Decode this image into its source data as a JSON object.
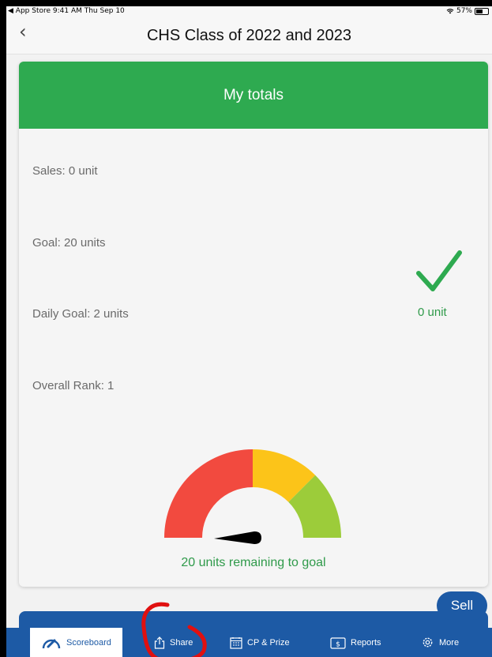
{
  "status_bar": {
    "left_text": "◀ App Store  9:41 AM  Thu Sep 10",
    "wifi_icon": "wifi-icon",
    "battery": "57%"
  },
  "nav": {
    "back_icon": "chevron-left-icon",
    "title": "CHS Class of 2022 and 2023"
  },
  "card": {
    "header": "My totals",
    "stats": [
      {
        "label": "Sales: 0 unit"
      },
      {
        "label": "Goal: 20 units"
      },
      {
        "label": "Daily Goal: 2 units"
      },
      {
        "label": "Overall Rank: 1"
      }
    ],
    "check_icon": "checkmark-icon",
    "units_today": "0 unit",
    "gauge": {
      "progress": 0,
      "segment_colors": [
        "#f24a3f",
        "#fcc419",
        "#9ccc3a"
      ]
    },
    "remaining_text": "20 units remaining to goal"
  },
  "sell_button": "Sell",
  "tabs": [
    {
      "label": "Scoreboard",
      "icon": "speedometer-icon",
      "active": true
    },
    {
      "label": "Share",
      "icon": "share-icon",
      "active": false
    },
    {
      "label": "CP & Prize",
      "icon": "calendar-icon",
      "active": false
    },
    {
      "label": "Reports",
      "icon": "dollar-receipt-icon",
      "active": false
    },
    {
      "label": "More",
      "icon": "gear-icon",
      "active": false
    }
  ],
  "colors": {
    "header_green": "#2eaa50",
    "text_green": "#2f9a4a",
    "tab_blue": "#1d5aa5",
    "annotation_red": "#e01010"
  }
}
